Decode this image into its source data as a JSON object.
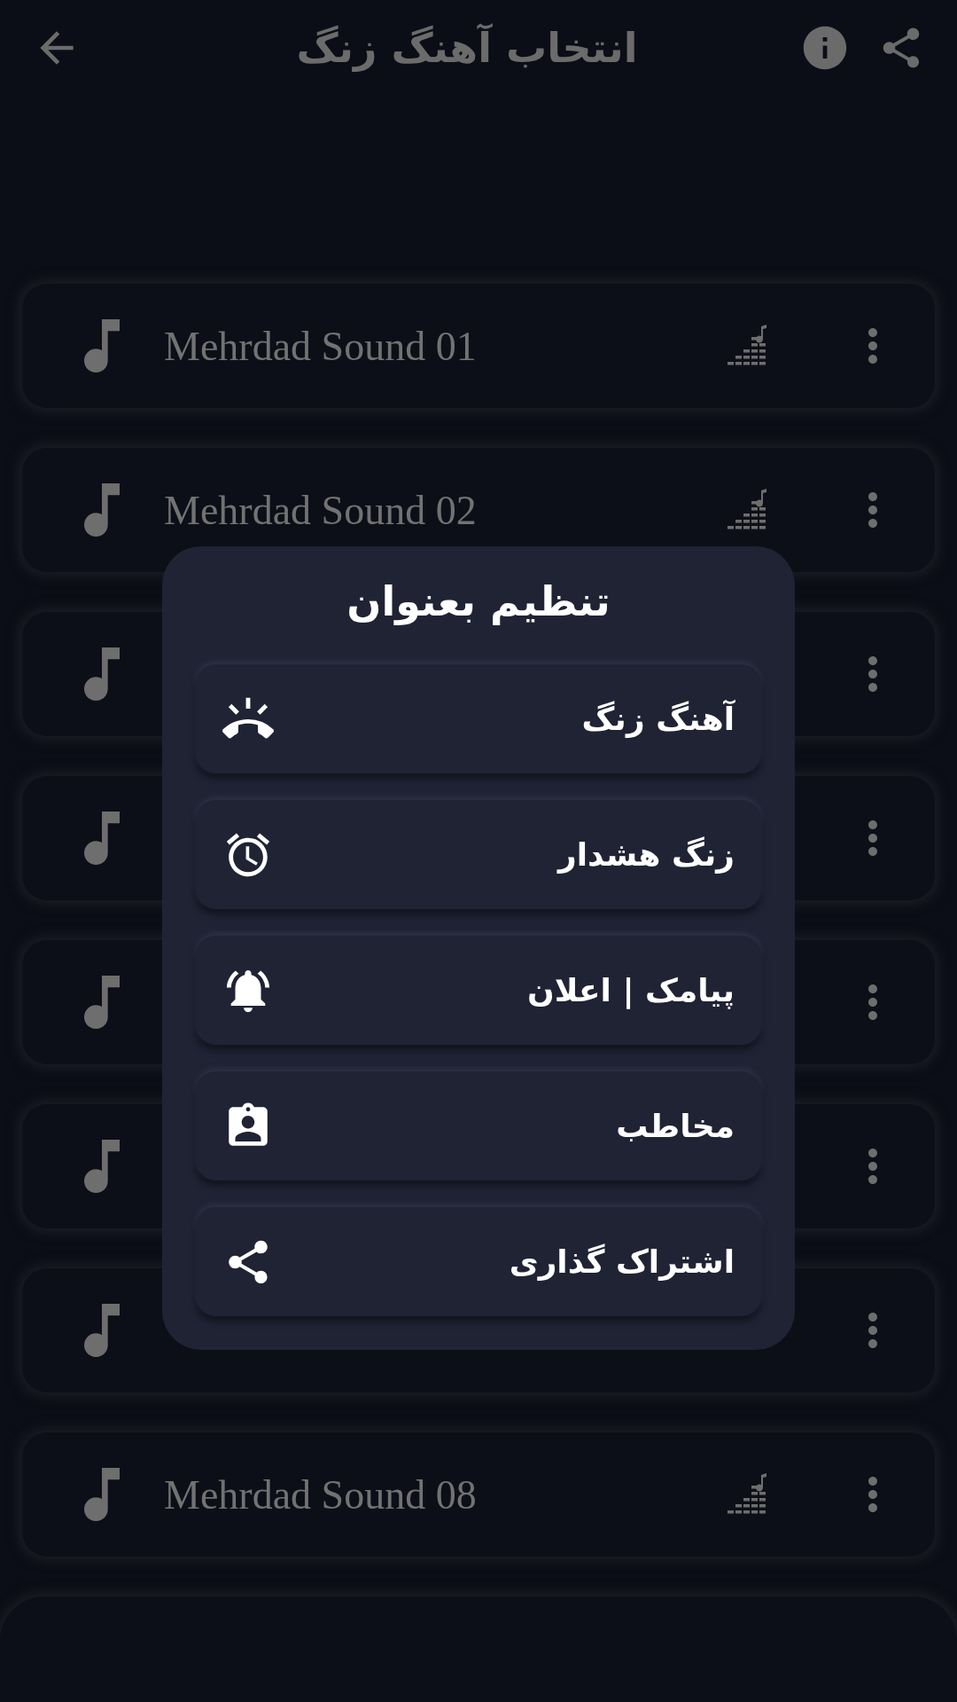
{
  "header": {
    "title": "انتخاب آهنگ زنگ"
  },
  "songs": [
    {
      "kind": "track",
      "title": "Mehrdad Sound 01"
    },
    {
      "kind": "track",
      "title": "Mehrdad Sound 02"
    },
    {
      "kind": "covered"
    },
    {
      "kind": "covered"
    },
    {
      "kind": "covered"
    },
    {
      "kind": "covered"
    },
    {
      "kind": "covered"
    },
    {
      "kind": "track",
      "title": "Mehrdad Sound 08"
    }
  ],
  "dialog": {
    "title": "تنظیم بعنوان",
    "options": [
      {
        "label": "آهنگ زنگ",
        "kind": "ringtone"
      },
      {
        "label": "زنگ هشدار",
        "kind": "alarm"
      },
      {
        "label": "پیامک | اعلان",
        "kind": "notification"
      },
      {
        "label": "مخاطب",
        "kind": "contact"
      },
      {
        "label": "اشتراک گذاری",
        "kind": "share"
      }
    ]
  }
}
